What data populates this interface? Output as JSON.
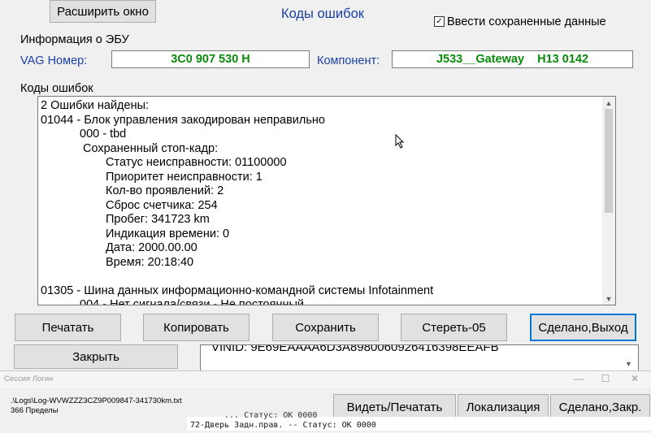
{
  "top": {
    "expand_button": "Расширить окно",
    "title": "Коды ошибок",
    "checkbox_label": "Ввести сохраненные данные",
    "checkbox_mark": "✓"
  },
  "ecu": {
    "section_label": "Информация о ЭБУ",
    "vag_label": "VAG Номер:",
    "vag_value": "3C0 907 530 H",
    "component_label": "Компонент:",
    "component_value": "J533__Gateway    H13 0142"
  },
  "codes": {
    "label": "Коды ошибок",
    "lines": [
      "2 Ошибки найдены:",
      "01044 - Блок управления закодирован неправильно",
      "000 - tbd",
      "Сохраненный стоп-кадр:",
      "Статус неисправности: 01100000",
      "Приоритет неисправности: 1",
      "Кол-во проявлений: 2",
      "Сброс счетчика: 254",
      "Пробег: 341723 km",
      "Индикация времени: 0",
      "Дата: 2000.00.00",
      "Время: 20:18:40",
      "",
      "01305 - Шина данных информационно-командной системы Infotainment",
      "004 - Нет сигнала/связи - Не постоянный"
    ]
  },
  "buttons": {
    "print": "Печатать",
    "copy": "Копировать",
    "save": "Сохранить",
    "clear": "Стереть-05",
    "done_exit": "Сделано,Выход"
  },
  "background": {
    "close": "Закрыть",
    "vin_text": "VINID: 9E69EAAAA6D3A8980060926416398EEAFB"
  },
  "login": {
    "title": "Сессия Логин",
    "log_path": ".\\Logs\\Log-WVWZZZ3CZ9P009847-341730km.txt",
    "limits": "366 Пределы",
    "view_print": "Видеть/Печатать",
    "localization": "Локализация",
    "done_close": "Сделано,Закр.",
    "log_line_1": "... Статус: OK 0000",
    "log_line_2": "72-Дверь Задн.прав. -- Статус: OK 0000"
  },
  "icons": {
    "scroll_up": "▲",
    "scroll_down": "▼",
    "minimize": "—",
    "maximize": "☐",
    "close": "✕"
  }
}
